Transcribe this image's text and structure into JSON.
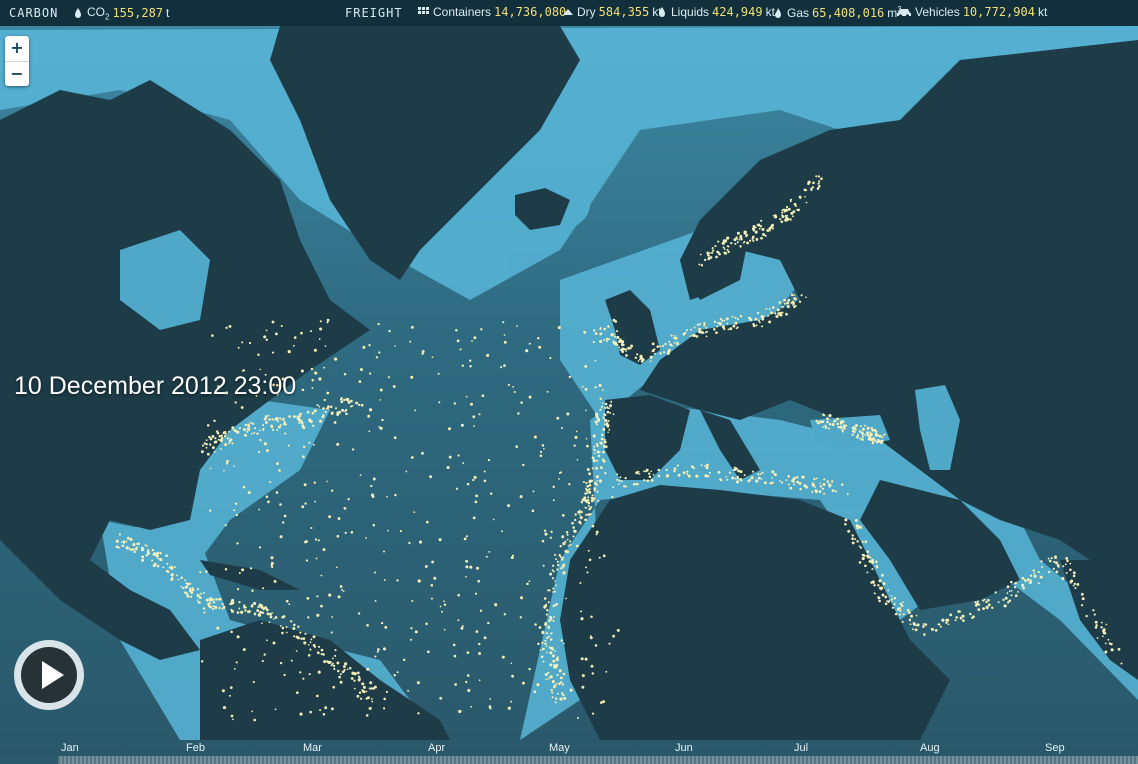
{
  "topbar": {
    "carbon_label": "CARBON",
    "co2": {
      "label": "CO",
      "sub": "2",
      "value": "155,287",
      "unit": "t",
      "icon": "drop-icon"
    },
    "freight_label": "FREIGHT",
    "metrics": [
      {
        "label": "Containers",
        "value": "14,736,080",
        "unit": "",
        "icon": "grid-icon"
      },
      {
        "label": "Dry",
        "value": "584,355",
        "unit": "kt",
        "icon": "pile-icon"
      },
      {
        "label": "Liquids",
        "value": "424,949",
        "unit": "kt",
        "icon": "drop-icon"
      },
      {
        "label": "Gas",
        "value": "65,408,016",
        "unit": "m",
        "sup": "3",
        "icon": "flame-icon"
      },
      {
        "label": "Vehicles",
        "value": "10,772,904",
        "unit": "kt",
        "icon": "car-icon"
      }
    ]
  },
  "zoom": {
    "in": "+",
    "out": "−"
  },
  "datetime": "10 December 2012 23:00",
  "timeline": {
    "months": [
      "Jan",
      "Feb",
      "Mar",
      "Apr",
      "May",
      "Jun",
      "Jul",
      "Aug",
      "Sep"
    ]
  },
  "colors": {
    "land": "#1d3c48",
    "ocean": "#2b5a6c",
    "shelf": "#58b6d8",
    "ship": "#f6f0b8",
    "topbar": "#11303c",
    "value": "#f2df7a"
  }
}
